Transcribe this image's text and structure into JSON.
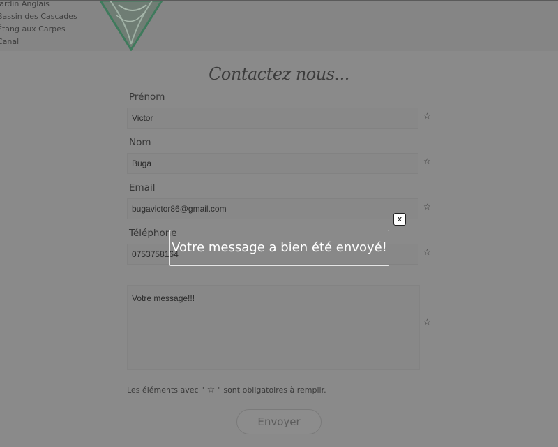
{
  "nav": {
    "items": [
      {
        "label": "Jardin Anglais"
      },
      {
        "label": "Bassin des Cascades"
      },
      {
        "label": "Étang aux Carpes"
      },
      {
        "label": "Canal"
      }
    ]
  },
  "contact": {
    "title": "Contactez nous...",
    "fields": [
      {
        "label": "Prénom",
        "value": "Victor"
      },
      {
        "label": "Nom",
        "value": "Buga"
      },
      {
        "label": "Email",
        "value": "bugavictor86@gmail.com"
      },
      {
        "label": "Téléphone",
        "value": "0753758164"
      }
    ],
    "message": {
      "value": "Votre message!!!"
    },
    "required_star": "☆",
    "note_before": "Les éléments avec \" ",
    "note_star": "☆",
    "note_after": " \" sont obligatoires à remplir.",
    "submit_label": "Envoyer"
  },
  "modal": {
    "message": "Votre message a bien été envoyé!",
    "close_label": "x"
  },
  "colors": {
    "overlay": "#8a8a8a",
    "logo_green": "#3f7a5c",
    "modal_border": "#e6e6e6"
  }
}
